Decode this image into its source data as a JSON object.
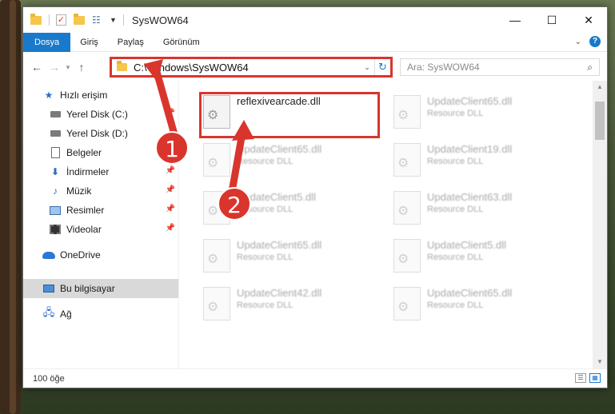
{
  "window": {
    "title": "SysWOW64",
    "minimize": "—",
    "maximize": "☐",
    "close": "✕"
  },
  "ribbon": {
    "tabs": [
      "Dosya",
      "Giriş",
      "Paylaş",
      "Görünüm"
    ],
    "help": "?"
  },
  "nav": {
    "address": "C:\\Windows\\SysWOW64",
    "search_placeholder": "Ara: SysWOW64"
  },
  "sidebar": {
    "items": [
      {
        "label": "Hızlı erişim",
        "icon": "star-icon"
      },
      {
        "label": "Yerel Disk (C:)",
        "icon": "drive-icon"
      },
      {
        "label": "Yerel Disk (D:)",
        "icon": "drive-icon"
      },
      {
        "label": "Belgeler",
        "icon": "documents-icon"
      },
      {
        "label": "İndirmeler",
        "icon": "download-icon"
      },
      {
        "label": "Müzik",
        "icon": "music-icon"
      },
      {
        "label": "Resimler",
        "icon": "pictures-icon"
      },
      {
        "label": "Videolar",
        "icon": "videos-icon"
      },
      {
        "label": "OneDrive",
        "icon": "cloud-icon"
      },
      {
        "label": "Bu bilgisayar",
        "icon": "computer-icon"
      },
      {
        "label": "Ağ",
        "icon": "network-icon"
      }
    ]
  },
  "files": {
    "main": {
      "name": "reflexivearcade.dll",
      "type": ""
    },
    "others": [
      {
        "name": "UpdateClient65.dll",
        "type": "Resource DLL"
      },
      {
        "name": "UpdateClient65.dll",
        "type": "Resource DLL"
      },
      {
        "name": "UpdateClient19.dll",
        "type": "Resource DLL"
      },
      {
        "name": "UpdateClient5.dll",
        "type": "Resource DLL"
      },
      {
        "name": "UpdateClient63.dll",
        "type": "Resource DLL"
      },
      {
        "name": "UpdateClient65.dll",
        "type": "Resource DLL"
      },
      {
        "name": "UpdateClient5.dll",
        "type": "Resource DLL"
      },
      {
        "name": "UpdateClient42.dll",
        "type": "Resource DLL"
      },
      {
        "name": "UpdateClient65.dll",
        "type": "Resource DLL"
      }
    ]
  },
  "status": {
    "count": "100 öğe"
  },
  "annotations": {
    "marker1": "1",
    "marker2": "2",
    "color": "#d9352d"
  },
  "colors": {
    "accent": "#1979ca"
  }
}
